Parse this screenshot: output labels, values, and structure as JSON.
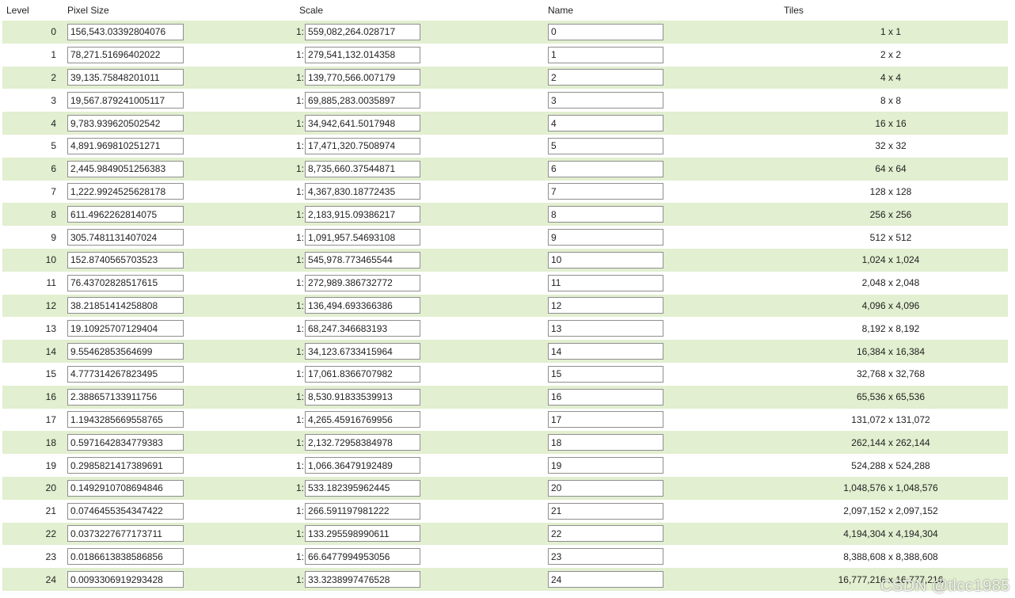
{
  "headers": {
    "level": "Level",
    "pixel_size": "Pixel Size",
    "scale": "Scale",
    "name": "Name",
    "tiles": "Tiles"
  },
  "scale_prefix": "1:",
  "rows": [
    {
      "level": "0",
      "pixel_size": "156,543.03392804076",
      "scale": "559,082,264.028717",
      "name": "0",
      "tiles": "1 x 1"
    },
    {
      "level": "1",
      "pixel_size": "78,271.51696402022",
      "scale": "279,541,132.014358",
      "name": "1",
      "tiles": "2 x 2"
    },
    {
      "level": "2",
      "pixel_size": "39,135.75848201011",
      "scale": "139,770,566.007179",
      "name": "2",
      "tiles": "4 x 4"
    },
    {
      "level": "3",
      "pixel_size": "19,567.879241005117",
      "scale": "69,885,283.0035897",
      "name": "3",
      "tiles": "8 x 8"
    },
    {
      "level": "4",
      "pixel_size": "9,783.939620502542",
      "scale": "34,942,641.5017948",
      "name": "4",
      "tiles": "16 x 16"
    },
    {
      "level": "5",
      "pixel_size": "4,891.969810251271",
      "scale": "17,471,320.7508974",
      "name": "5",
      "tiles": "32 x 32"
    },
    {
      "level": "6",
      "pixel_size": "2,445.9849051256383",
      "scale": "8,735,660.37544871",
      "name": "6",
      "tiles": "64 x 64"
    },
    {
      "level": "7",
      "pixel_size": "1,222.9924525628178",
      "scale": "4,367,830.18772435",
      "name": "7",
      "tiles": "128 x 128"
    },
    {
      "level": "8",
      "pixel_size": "611.4962262814075",
      "scale": "2,183,915.09386217",
      "name": "8",
      "tiles": "256 x 256"
    },
    {
      "level": "9",
      "pixel_size": "305.7481131407024",
      "scale": "1,091,957.54693108",
      "name": "9",
      "tiles": "512 x 512"
    },
    {
      "level": "10",
      "pixel_size": "152.8740565703523",
      "scale": "545,978.773465544",
      "name": "10",
      "tiles": "1,024 x 1,024"
    },
    {
      "level": "11",
      "pixel_size": "76.43702828517615",
      "scale": "272,989.386732772",
      "name": "11",
      "tiles": "2,048 x 2,048"
    },
    {
      "level": "12",
      "pixel_size": "38.21851414258808",
      "scale": "136,494.693366386",
      "name": "12",
      "tiles": "4,096 x 4,096"
    },
    {
      "level": "13",
      "pixel_size": "19.10925707129404",
      "scale": "68,247.346683193",
      "name": "13",
      "tiles": "8,192 x 8,192"
    },
    {
      "level": "14",
      "pixel_size": "9.55462853564699",
      "scale": "34,123.6733415964",
      "name": "14",
      "tiles": "16,384 x 16,384"
    },
    {
      "level": "15",
      "pixel_size": "4.777314267823495",
      "scale": "17,061.8366707982",
      "name": "15",
      "tiles": "32,768 x 32,768"
    },
    {
      "level": "16",
      "pixel_size": "2.388657133911756",
      "scale": "8,530.91833539913",
      "name": "16",
      "tiles": "65,536 x 65,536"
    },
    {
      "level": "17",
      "pixel_size": "1.1943285669558765",
      "scale": "4,265.45916769956",
      "name": "17",
      "tiles": "131,072 x 131,072"
    },
    {
      "level": "18",
      "pixel_size": "0.5971642834779383",
      "scale": "2,132.72958384978",
      "name": "18",
      "tiles": "262,144 x 262,144"
    },
    {
      "level": "19",
      "pixel_size": "0.2985821417389691",
      "scale": "1,066.36479192489",
      "name": "19",
      "tiles": "524,288 x 524,288"
    },
    {
      "level": "20",
      "pixel_size": "0.1492910708694846",
      "scale": "533.182395962445",
      "name": "20",
      "tiles": "1,048,576 x 1,048,576"
    },
    {
      "level": "21",
      "pixel_size": "0.0746455354347422",
      "scale": "266.591197981222",
      "name": "21",
      "tiles": "2,097,152 x 2,097,152"
    },
    {
      "level": "22",
      "pixel_size": "0.0373227677173711",
      "scale": "133.295598990611",
      "name": "22",
      "tiles": "4,194,304 x 4,194,304"
    },
    {
      "level": "23",
      "pixel_size": "0.0186613838586856",
      "scale": "66.6477994953056",
      "name": "23",
      "tiles": "8,388,608 x 8,388,608"
    },
    {
      "level": "24",
      "pixel_size": "0.0093306919293428",
      "scale": "33.3238997476528",
      "name": "24",
      "tiles": "16,777,216 x 16,777,216"
    }
  ],
  "watermark": "CSDN @tlcc1985"
}
